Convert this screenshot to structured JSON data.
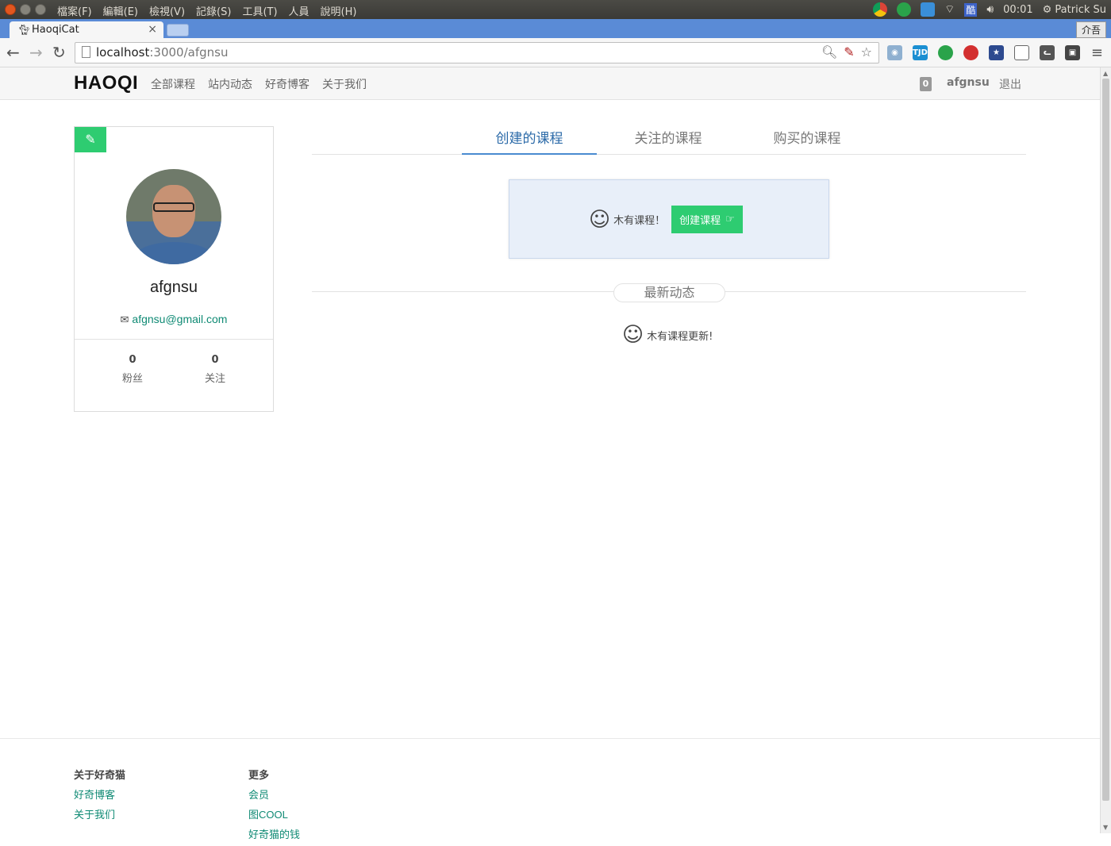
{
  "os": {
    "menu": [
      "檔案(F)",
      "編輯(E)",
      "檢視(V)",
      "記錄(S)",
      "工具(T)",
      "人員",
      "說明(H)"
    ],
    "clock": "00:01",
    "user": "Patrick Su",
    "ime": "酷"
  },
  "browser": {
    "tab_title": "HaoqiCat",
    "tab_ime": "介吾",
    "url_host": "localhost",
    "url_path": ":3000/afgnsu"
  },
  "site": {
    "logo": "HAOQI",
    "nav": [
      "全部课程",
      "站内动态",
      "好奇博客",
      "关于我们"
    ],
    "notif_count": "0",
    "username": "afgnsu",
    "logout": "退出"
  },
  "profile": {
    "name": "afgnsu",
    "email": "afgnsu@gmail.com",
    "fans_count": "0",
    "fans_label": "粉丝",
    "follow_count": "0",
    "follow_label": "关注"
  },
  "tabs": [
    "创建的课程",
    "关注的课程",
    "购买的课程"
  ],
  "empty_courses": {
    "text": "木有课程！",
    "button": "创建课程"
  },
  "news": {
    "title": "最新动态",
    "empty": "木有课程更新!"
  },
  "footer": {
    "col1_title": "关于好奇猫",
    "col1_links": [
      "好奇博客",
      "关于我们"
    ],
    "col2_title": "更多",
    "col2_links": [
      "会员",
      "图COOL",
      "好奇猫的钱"
    ]
  },
  "colors": {
    "accent_green": "#2ecc71",
    "link_teal": "#0f8a74",
    "tab_active": "#2b6aa8"
  }
}
